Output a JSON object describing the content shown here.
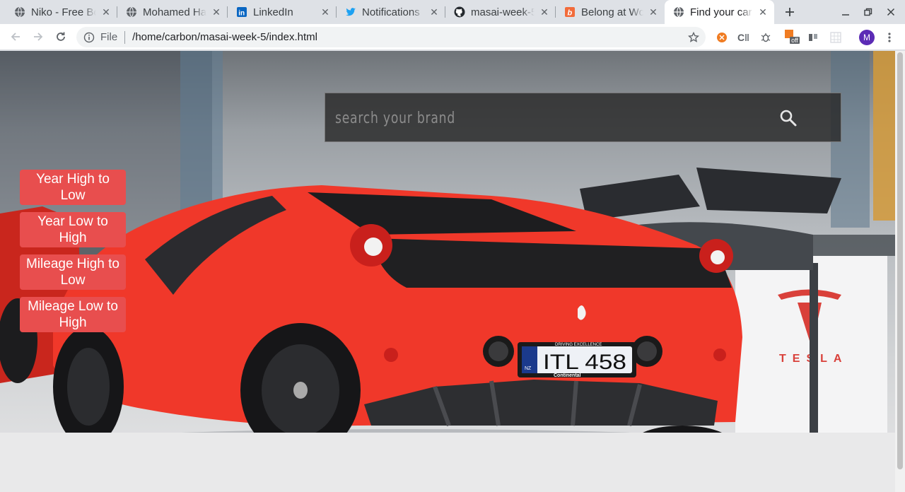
{
  "browser": {
    "tabs": [
      {
        "title": "Niko - Free Bo",
        "icon": "globe-icon",
        "active": false
      },
      {
        "title": "Mohamed Ha",
        "icon": "globe-icon",
        "active": false
      },
      {
        "title": "LinkedIn",
        "icon": "linkedin-icon",
        "active": false
      },
      {
        "title": "Notifications",
        "icon": "twitter-icon",
        "active": false
      },
      {
        "title": "masai-week-5",
        "icon": "github-icon",
        "active": false
      },
      {
        "title": "Belong at Wo",
        "icon": "belong-icon",
        "active": false
      },
      {
        "title": "Find your car",
        "icon": "globe-icon",
        "active": true
      }
    ],
    "omnibox": {
      "chip": "File",
      "url": "/home/carbon/masai-week-5/index.html"
    },
    "extensions": {
      "badge": "off",
      "profile_initial": "M"
    },
    "colors": {
      "profile": "#5b2bb5",
      "linkedin": "#0a66c2",
      "twitter": "#1da1f2",
      "belong": "#f26b3a"
    }
  },
  "page": {
    "search": {
      "placeholder": "search your brand",
      "icon": "search-icon"
    },
    "sort_buttons": [
      {
        "label": "Year High to Low"
      },
      {
        "label": "Year Low to High"
      },
      {
        "label": "Mileage High to Low"
      },
      {
        "label": "Mileage Low to High"
      }
    ],
    "hero": {
      "plate": "ITL 458",
      "plate_country": "NZ",
      "plate_top": "DRIVING EXCELLENCE",
      "plate_bottom": "Continental",
      "wall_sign": "TESLA"
    },
    "colors": {
      "accent": "#e84e4e",
      "car": "#f0382a"
    }
  }
}
